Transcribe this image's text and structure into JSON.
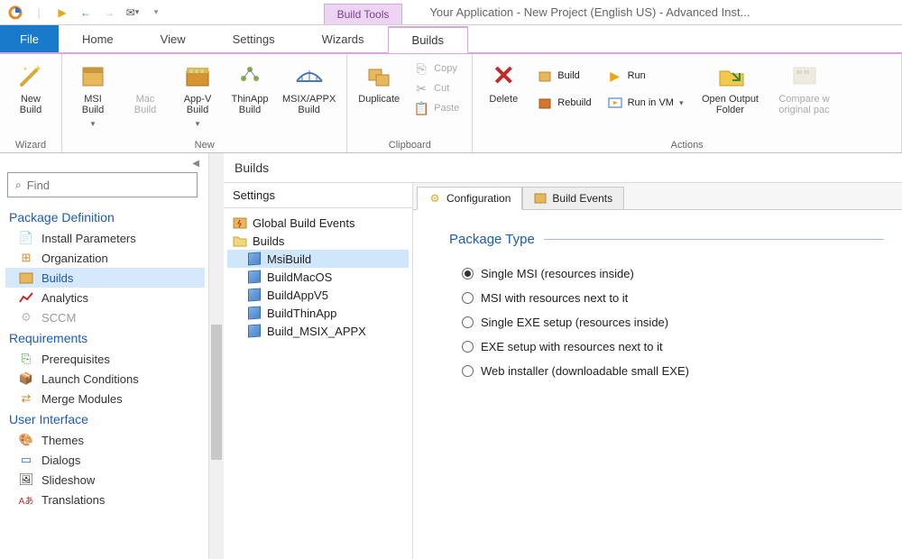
{
  "titlebar": {
    "context_tab": "Build Tools",
    "app_title": "Your Application - New Project (English US) - Advanced Inst..."
  },
  "menu": {
    "file": "File",
    "items": [
      "Home",
      "View",
      "Settings",
      "Wizards",
      "Builds"
    ],
    "active": "Builds"
  },
  "ribbon": {
    "wizard": {
      "label": "Wizard",
      "new_build": "New\nBuild"
    },
    "new": {
      "label": "New",
      "msi": "MSI\nBuild",
      "mac": "Mac\nBuild",
      "appv": "App-V\nBuild",
      "thinapp": "ThinApp\nBuild",
      "msix": "MSIX/APPX\nBuild"
    },
    "clipboard": {
      "label": "Clipboard",
      "duplicate": "Duplicate",
      "copy": "Copy",
      "cut": "Cut",
      "paste": "Paste"
    },
    "actions": {
      "label": "Actions",
      "delete": "Delete",
      "build": "Build",
      "rebuild": "Rebuild",
      "run": "Run",
      "run_vm": "Run in VM",
      "open_output": "Open Output\nFolder",
      "compare": "Compare w\noriginal pac"
    }
  },
  "left": {
    "search_placeholder": "Find",
    "sections": {
      "package_def": "Package Definition",
      "requirements": "Requirements",
      "ui": "User Interface"
    },
    "items": {
      "install_params": "Install Parameters",
      "organization": "Organization",
      "builds": "Builds",
      "analytics": "Analytics",
      "sccm": "SCCM",
      "prereq": "Prerequisites",
      "launch": "Launch Conditions",
      "merge": "Merge Modules",
      "themes": "Themes",
      "dialogs": "Dialogs",
      "slideshow": "Slideshow",
      "translations": "Translations"
    }
  },
  "center": {
    "header": "Builds",
    "settings_title": "Settings",
    "tree": {
      "global": "Global Build Events",
      "builds": "Builds",
      "items": [
        "MsiBuild",
        "BuildMacOS",
        "BuildAppV5",
        "BuildThinApp",
        "Build_MSIX_APPX"
      ],
      "selected": "MsiBuild"
    },
    "tabs": {
      "config": "Configuration",
      "events": "Build Events"
    },
    "package_type": {
      "title": "Package Type",
      "options": [
        "Single MSI (resources inside)",
        "MSI with resources next to it",
        "Single EXE setup (resources inside)",
        "EXE setup with resources next to it",
        "Web installer (downloadable small EXE)"
      ],
      "selected": 0
    }
  }
}
